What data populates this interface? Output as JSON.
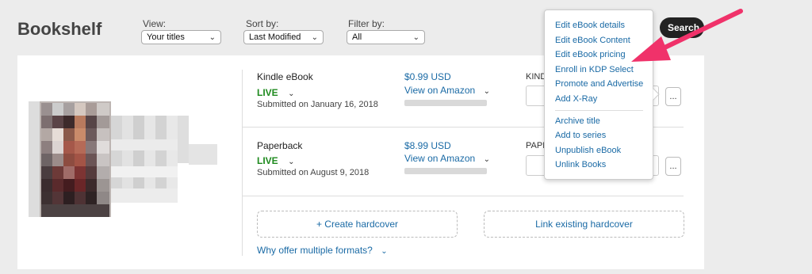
{
  "header": {
    "title": "Bookshelf",
    "view_label": "View:",
    "view_value": "Your titles",
    "sort_label": "Sort by:",
    "sort_value": "Last Modified",
    "filter_label": "Filter by:",
    "filter_value": "All",
    "search_button": "Search"
  },
  "formats": [
    {
      "name": "Kindle eBook",
      "status": "LIVE",
      "submitted": "Submitted on January 16, 2018",
      "price": "$0.99 USD",
      "view_link": "View on Amazon",
      "cut_label": "KINDLE"
    },
    {
      "name": "Paperback",
      "status": "LIVE",
      "submitted": "Submitted on August 9, 2018",
      "price": "$8.99 USD",
      "view_link": "View on Amazon",
      "cut_label": "PAPERBACK"
    }
  ],
  "actions": {
    "create_hardcover": "+ Create hardcover",
    "link_hardcover": "Link existing hardcover",
    "why_formats": "Why offer multiple formats?",
    "more": "..."
  },
  "menu": {
    "group1": [
      "Edit eBook details",
      "Edit eBook Content",
      "Edit eBook pricing",
      "Enroll in KDP Select",
      "Promote and Advertise",
      "Add X-Ray"
    ],
    "group2": [
      "Archive title",
      "Add to series",
      "Unpublish eBook",
      "Unlink Books"
    ]
  },
  "colors": {
    "live": "#1e8a1e",
    "link": "#1a6aa5",
    "arrow": "#f0326a"
  },
  "icons": {
    "dropdown": "chevron-down-icon",
    "annotation": "arrow-pointer"
  }
}
